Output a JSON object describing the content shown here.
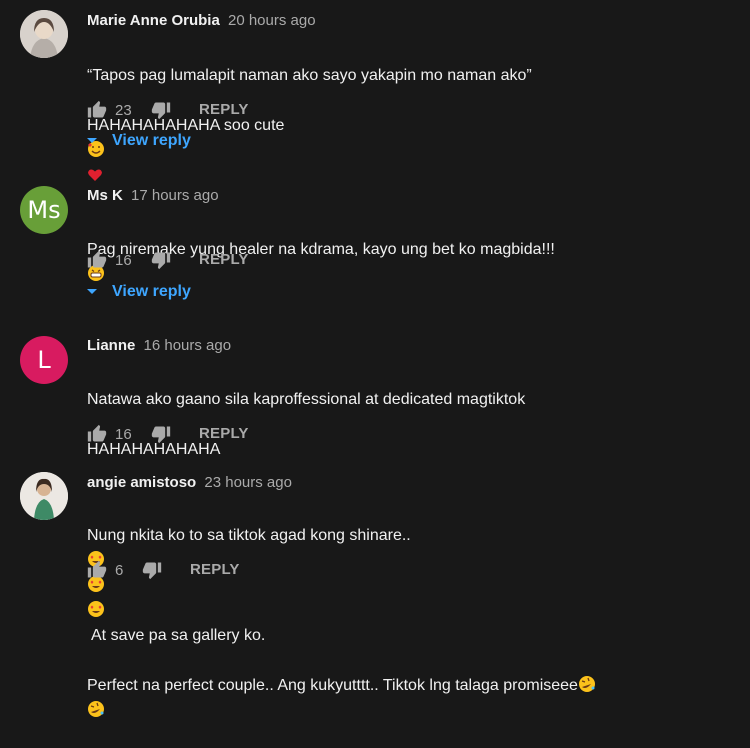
{
  "comments": [
    {
      "author": "Marie Anne Orubia",
      "time": "20 hours ago",
      "line1": "“Tapos pag lumalapit naman ako sayo yakapin mo naman ako”",
      "line2": "HAHAHAHAHAHA soo cute",
      "likes": "23",
      "reply_label": "REPLY",
      "view_reply": "View reply",
      "avatar_color": "#c9c2bd"
    },
    {
      "author": "Ms K",
      "time": "17 hours ago",
      "line1": "Pag niremake yung healer na kdrama, kayo ung bet ko magbida!!!",
      "likes": "16",
      "reply_label": "REPLY",
      "view_reply": "View reply",
      "avatar_letters": "Ms",
      "avatar_color": "#689f38"
    },
    {
      "author": "Lianne",
      "time": "16 hours ago",
      "line1": "Natawa ako gaano sila kaproffessional at dedicated magtiktok",
      "line2": "HAHAHAHAHAHA",
      "likes": "16",
      "reply_label": "REPLY",
      "avatar_letters": "L",
      "avatar_color": "#d81b60"
    },
    {
      "author": "angie amistoso",
      "time": "23 hours ago",
      "line1": "Nung nkita ko to sa tiktok agad kong shinare..",
      "line1b": "At save pa sa gallery ko.",
      "line2": "Perfect na perfect couple.. Ang kukyutttt.. Tiktok lng talaga promiseee",
      "likes": "6",
      "reply_label": "REPLY",
      "avatar_color": "#e8e4df"
    }
  ],
  "colors": {
    "background": "#181818",
    "link": "#3ea6ff",
    "muted": "#aaaaaa"
  },
  "icons": [
    "thumb-up-icon",
    "thumb-down-icon",
    "caret-down-icon"
  ]
}
